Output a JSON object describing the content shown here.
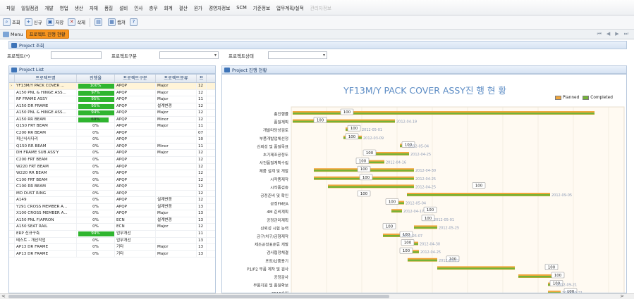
{
  "menu": [
    "파일",
    "일일점검",
    "개발",
    "영업",
    "생산",
    "자재",
    "품질",
    "설비",
    "인사",
    "총무",
    "회계",
    "결산",
    "원가",
    "경영자정보",
    "SCM",
    "기준정보",
    "업무계획/실적",
    "관리자정보"
  ],
  "toolbar": {
    "search": "조회",
    "new": "신규",
    "save": "저장",
    "delete": "삭제",
    "print": "",
    "capture": "캡쳐",
    "help": "?"
  },
  "tabstrip": {
    "menu": "Menu",
    "active": "프로젝트 진행 현황",
    "nav": [
      "⏮",
      "◀",
      "▶",
      "⏭"
    ]
  },
  "project_search": {
    "title": "Project 조회",
    "fields": [
      {
        "label": "프로젝트(*)",
        "value": ""
      },
      {
        "label": "프로젝트구분",
        "value": ""
      },
      {
        "label": "프로젝트상태",
        "value": ""
      }
    ]
  },
  "project_list": {
    "title": "Project List",
    "columns": [
      "프로젝트명",
      "진행율",
      "프로젝트구분",
      "프로젝트분류",
      "프"
    ],
    "rows": [
      {
        "name": "YF13M/Y PACK COVER ...",
        "progress": "100%",
        "pct": 100,
        "type": "APQP",
        "cls": "Major",
        "x": "12"
      },
      {
        "name": "A150 PNL & HINGE ASS...",
        "progress": "97%",
        "pct": 97,
        "type": "APQP",
        "cls": "Major",
        "x": "12"
      },
      {
        "name": "RP FRAME ASSY",
        "progress": "95%",
        "pct": 95,
        "type": "APQP",
        "cls": "Major",
        "x": "11"
      },
      {
        "name": "A150 DR FRAME",
        "progress": "95%",
        "pct": 95,
        "type": "APQP",
        "cls": "설계변경",
        "x": "12"
      },
      {
        "name": "A150 PNL & HINGE ASS...",
        "progress": "94%",
        "pct": 94,
        "type": "APQP",
        "cls": "Major",
        "x": "12"
      },
      {
        "name": "A150 RR BEAM",
        "progress": "69%",
        "pct": 69,
        "type": "APQP",
        "cls": "Minor",
        "x": "12"
      },
      {
        "name": "Q150 FRT BEAM",
        "progress": "0%",
        "pct": 0,
        "type": "APQP",
        "cls": "Major",
        "x": "11"
      },
      {
        "name": "C200 RR BEAM",
        "progress": "0%",
        "pct": 0,
        "type": "APQP",
        "cls": "",
        "x": "07"
      },
      {
        "name": "피난식사다리",
        "progress": "0%",
        "pct": 0,
        "type": "APQP",
        "cls": "",
        "x": "10"
      },
      {
        "name": "Q150 RR BEAM",
        "progress": "0%",
        "pct": 0,
        "type": "APQP",
        "cls": "Minor",
        "x": "11"
      },
      {
        "name": "DH FRAME SUB ASS'Y",
        "progress": "0%",
        "pct": 0,
        "type": "APQP",
        "cls": "Major",
        "x": "12"
      },
      {
        "name": "C200 FRT BEAM",
        "progress": "0%",
        "pct": 0,
        "type": "APQP",
        "cls": "",
        "x": "12"
      },
      {
        "name": "W220 FRT BEAM",
        "progress": "0%",
        "pct": 0,
        "type": "APQP",
        "cls": "",
        "x": "12"
      },
      {
        "name": "W220 RR BEAM",
        "progress": "0%",
        "pct": 0,
        "type": "APQP",
        "cls": "",
        "x": "12"
      },
      {
        "name": "C100 FRT BEAM",
        "progress": "0%",
        "pct": 0,
        "type": "APQP",
        "cls": "",
        "x": "12"
      },
      {
        "name": "C100 RR BEAM",
        "progress": "0%",
        "pct": 0,
        "type": "APQP",
        "cls": "",
        "x": "12"
      },
      {
        "name": "MD DUST RING",
        "progress": "0%",
        "pct": 0,
        "type": "APQP",
        "cls": "",
        "x": "12"
      },
      {
        "name": "A149",
        "progress": "0%",
        "pct": 0,
        "type": "APQP",
        "cls": "설계변경",
        "x": "12"
      },
      {
        "name": "Y291 CROSS MEMBER A...",
        "progress": "0%",
        "pct": 0,
        "type": "APQP",
        "cls": "설계변경",
        "x": "13"
      },
      {
        "name": "X100 CROSS MEMBER A...",
        "progress": "0%",
        "pct": 0,
        "type": "APQP",
        "cls": "Major",
        "x": "13"
      },
      {
        "name": "A150 PNL F/APRON",
        "progress": "0%",
        "pct": 0,
        "type": "ECN",
        "cls": "설계변경",
        "x": "13"
      },
      {
        "name": "A150 SEAT RAIL",
        "progress": "0%",
        "pct": 0,
        "type": "ECN",
        "cls": "Major",
        "x": "12"
      },
      {
        "name": "ERP 신규구축",
        "progress": "94%",
        "pct": 94,
        "type": "업무개선",
        "cls": "",
        "x": "11"
      },
      {
        "name": "테스트 - 개선작업",
        "progress": "0%",
        "pct": 0,
        "type": "업무개선",
        "cls": "",
        "x": "13"
      },
      {
        "name": "AP13 DR FRAME",
        "progress": "0%",
        "pct": 0,
        "type": "기타",
        "cls": "Major",
        "x": "13"
      },
      {
        "name": "AP13 DR FRAME",
        "progress": "0%",
        "pct": 0,
        "type": "기타",
        "cls": "Major",
        "x": "13"
      }
    ]
  },
  "chart_panel": {
    "title": "Project 진행 현황"
  },
  "chart_data": {
    "type": "gantt",
    "title": "YF13M/Y PACK COVER ASSY진 행 현 황",
    "legend": [
      "Planned",
      "Completed"
    ],
    "colors": {
      "planned": "#f0a63c",
      "completed": "#74b336"
    },
    "tasks": [
      {
        "name": "총진행률",
        "pct": "100",
        "date": ""
      },
      {
        "name": "품질계획",
        "pct": "100",
        "date": "2012-04-19"
      },
      {
        "name": "개발타당성검토",
        "pct": "100",
        "date": "2012-05-01"
      },
      {
        "name": "부품개발업체선정",
        "pct": "100",
        "date": "2012-03-09"
      },
      {
        "name": "신뢰성 및 품질목표",
        "pct": "100",
        "date": "2012-05-04"
      },
      {
        "name": "초기제조공정도",
        "pct": "100",
        "date": "2012-04-25"
      },
      {
        "name": "사전품질계획수립",
        "pct": "100",
        "date": "2012-04-16"
      },
      {
        "name": "제품 설계 및 개발",
        "pct": "100",
        "date": "2012-04-30"
      },
      {
        "name": "시작품제작",
        "pct": "100",
        "date": "2012-04-25"
      },
      {
        "name": "시작품검증",
        "pct": "100",
        "date": "2012-04-25"
      },
      {
        "name": "공정준비 및 확인",
        "pct": "100",
        "date": "2012-09-05"
      },
      {
        "name": "공정FMEA",
        "pct": "100",
        "date": "2012-05-04"
      },
      {
        "name": "4M 준비계획",
        "pct": "100",
        "date": "2012-04-17"
      },
      {
        "name": "공정관리계획",
        "pct": "100",
        "date": "2012-05-01"
      },
      {
        "name": "신뢰성 시험 능력",
        "pct": "100",
        "date": "2012-05-25"
      },
      {
        "name": "금구/치구/금형제작",
        "pct": "100",
        "date": "2012-05-07"
      },
      {
        "name": "제조공정표준류 개발",
        "pct": "100",
        "date": "2012-04-30"
      },
      {
        "name": "검사협정체결",
        "pct": "100",
        "date": "2012-04-25"
      },
      {
        "name": "포장/납품용기",
        "pct": "100",
        "date": "2012-05-21"
      },
      {
        "name": "P1/P2 부품 제작 및 검사",
        "pct": "100",
        "date": ""
      },
      {
        "name": "공정감사",
        "pct": "100",
        "date": ""
      },
      {
        "name": "부품지원 및 품질확보",
        "pct": "100",
        "date": "2012-09-21"
      },
      {
        "name": "PPAP승인",
        "pct": "100",
        "date": "2012-09-21"
      }
    ]
  },
  "hscroll": {
    "left": "<",
    "right": ">"
  }
}
